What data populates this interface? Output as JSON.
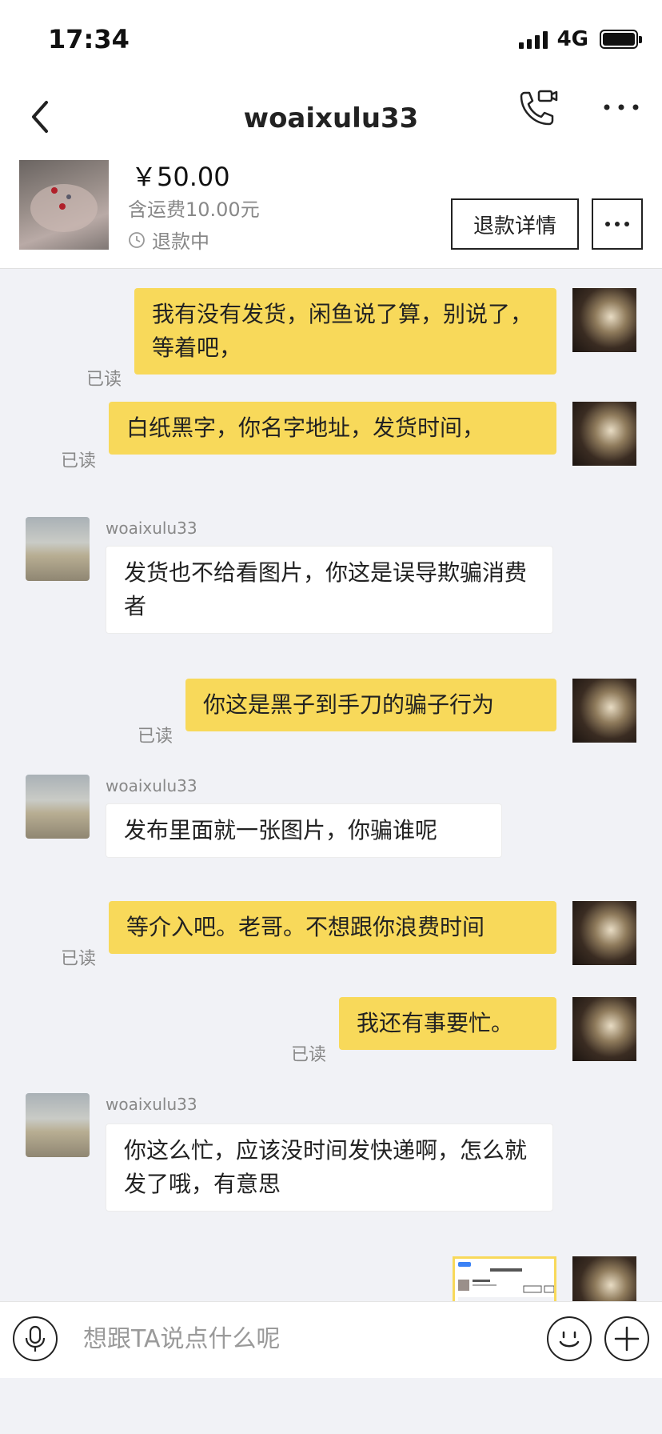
{
  "status_bar": {
    "time": "17:34",
    "network": "4G"
  },
  "nav": {
    "title": "woaixulu33"
  },
  "product": {
    "price": "￥50.00",
    "shipping": "含运费10.00元",
    "status": "退款中",
    "refund_button": "退款详情"
  },
  "messages": [
    {
      "from": "me",
      "text": "我有没有发货，闲鱼说了算，别说了，等着吧，",
      "read": "已读"
    },
    {
      "from": "me",
      "text": "白纸黑字，你名字地址，发货时间，",
      "read": "已读"
    },
    {
      "from": "them",
      "sender": "woaixulu33",
      "text": "发货也不给看图片，你这是误导欺骗消费者"
    },
    {
      "from": "me",
      "text": "你这是黑子到手刀的骗子行为",
      "read": "已读"
    },
    {
      "from": "them",
      "sender": "woaixulu33",
      "text": "发布里面就一张图片，你骗谁呢"
    },
    {
      "from": "me",
      "text": "等介入吧。老哥。不想跟你浪费时间",
      "read": "已读"
    },
    {
      "from": "me",
      "text": "我还有事要忙。",
      "read": "已读"
    },
    {
      "from": "them",
      "sender": "woaixulu33",
      "text": "你这么忙，应该没时间发快递啊，怎么就发了哦，有意思"
    },
    {
      "from": "me",
      "type": "screenshot-image"
    }
  ],
  "input": {
    "placeholder": "想跟TA说点什么呢"
  },
  "icons": {
    "back": "chevron-left-icon",
    "call": "video-call-icon",
    "more": "more-dots-icon",
    "clock": "clock-icon",
    "mic": "microphone-icon",
    "emoji": "emoji-icon",
    "add": "plus-icon"
  },
  "colors": {
    "my_bubble": "#f8d95a",
    "their_bubble": "#ffffff",
    "background": "#f1f2f6"
  }
}
